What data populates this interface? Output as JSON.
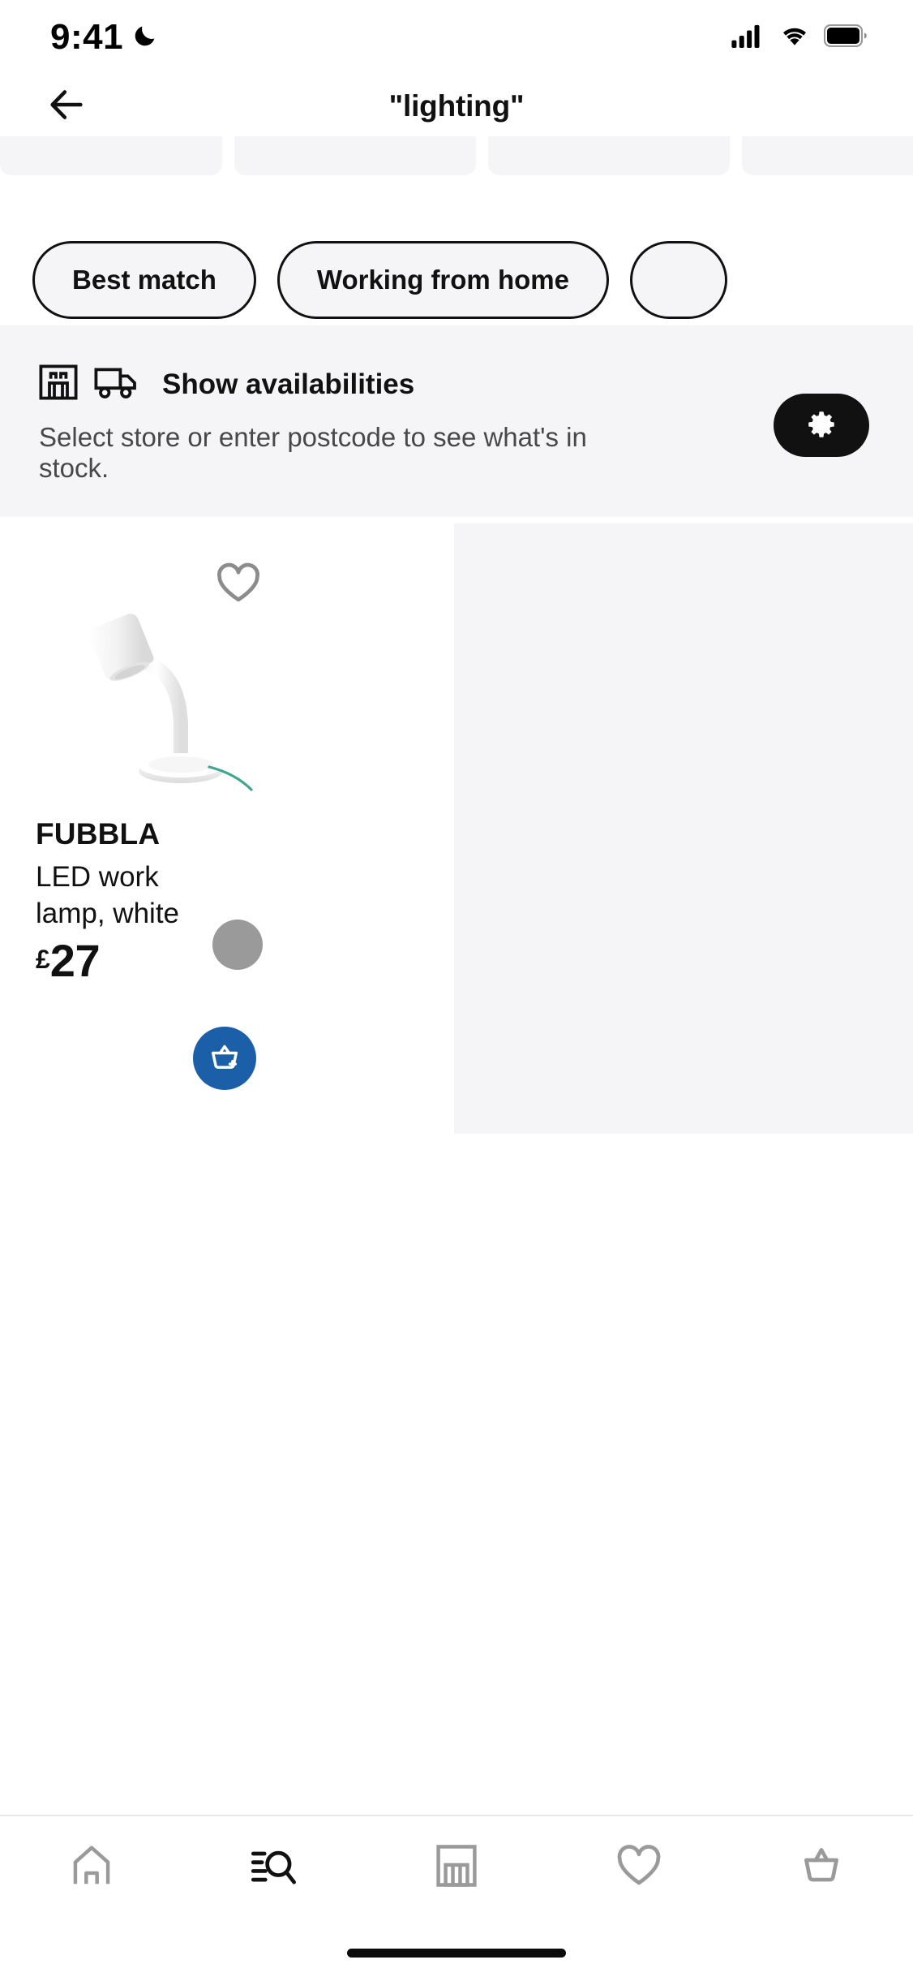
{
  "status_bar": {
    "time": "9:41",
    "dnd_icon": "moon-icon",
    "cellular_icon": "signal-bars-icon",
    "wifi_icon": "wifi-icon",
    "battery_icon": "battery-full-icon"
  },
  "header": {
    "back_icon": "arrow-left-icon",
    "title": "\"lighting\""
  },
  "card_strip": {
    "placeholder_count": 4
  },
  "filter_chips": [
    {
      "label": "Best match"
    },
    {
      "label": "Working from home"
    },
    {
      "label": ""
    }
  ],
  "availability": {
    "store_icon": "store-icon",
    "truck_icon": "delivery-truck-icon",
    "title": "Show availabilities",
    "subtitle": "Select store or enter postcode to see what's in stock.",
    "settings_icon": "gear-icon",
    "settings_button_color": "#111111",
    "background_color": "#f5f5f7"
  },
  "products": [
    {
      "name": "FUBBLA",
      "description": "LED work lamp, white",
      "price_currency": "£",
      "price_value": "27",
      "swatch_color": "#9a9a9a",
      "wishlist_icon": "heart-outline-icon",
      "add_to_cart_icon": "basket-plus-icon",
      "add_to_cart_color": "#1a5fa8",
      "image_alt": "white-led-work-lamp"
    }
  ],
  "bottom_nav": [
    {
      "name": "home",
      "icon": "home-icon",
      "active": false
    },
    {
      "name": "search",
      "icon": "search-list-icon",
      "active": true
    },
    {
      "name": "stores",
      "icon": "store-icon",
      "active": false
    },
    {
      "name": "wishlist",
      "icon": "heart-outline-icon",
      "active": false
    },
    {
      "name": "basket",
      "icon": "basket-icon",
      "active": false
    }
  ],
  "colors": {
    "accent_blue": "#1a5fa8",
    "surface_gray": "#f5f5f7",
    "text_primary": "#111111",
    "text_secondary": "#484848",
    "icon_inactive": "#9a9a9a"
  }
}
